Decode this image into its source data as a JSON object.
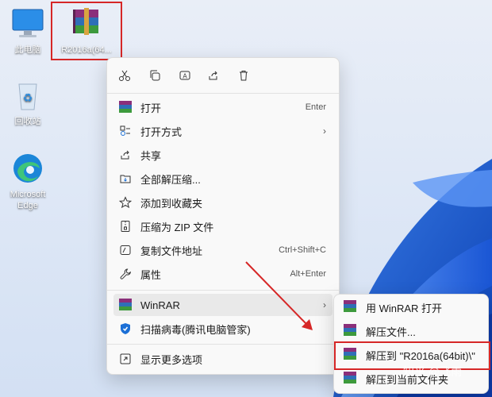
{
  "desktop": {
    "icons": [
      {
        "label": "此电脑",
        "icon": "computer-icon"
      },
      {
        "label": "R2016a(64...",
        "icon": "winrar-archive-icon"
      },
      {
        "label": "回收站",
        "icon": "recycle-bin-icon"
      },
      {
        "label": "Microsoft Edge",
        "icon": "edge-icon"
      }
    ]
  },
  "context_menu": {
    "toolbar": [
      "cut-icon",
      "copy-icon",
      "rename-icon",
      "share-icon",
      "delete-icon"
    ],
    "items": [
      {
        "label": "打开",
        "shortcut": "Enter",
        "icon": "winrar-icon"
      },
      {
        "label": "打开方式",
        "submenu": "›",
        "icon": "open-with-icon"
      },
      {
        "label": "共享",
        "icon": "share-icon"
      },
      {
        "label": "全部解压缩...",
        "icon": "extract-all-icon"
      },
      {
        "label": "添加到收藏夹",
        "icon": "star-icon"
      },
      {
        "label": "压缩为 ZIP 文件",
        "icon": "zip-icon"
      },
      {
        "label": "复制文件地址",
        "shortcut": "Ctrl+Shift+C",
        "icon": "copy-path-icon"
      },
      {
        "label": "属性",
        "shortcut": "Alt+Enter",
        "icon": "wrench-icon"
      },
      {
        "label": "WinRAR",
        "submenu": "›",
        "icon": "winrar-icon"
      },
      {
        "label": "扫描病毒(腾讯电脑管家)",
        "icon": "shield-icon"
      },
      {
        "label": "显示更多选项",
        "icon": "more-options-icon"
      }
    ]
  },
  "winrar_submenu": {
    "items": [
      {
        "label": "用 WinRAR 打开"
      },
      {
        "label": "解压文件..."
      },
      {
        "label": "解压到 \"R2016a(64bit)\\\""
      },
      {
        "label": "解压到当前文件夹"
      }
    ]
  },
  "watermark": "知乎 @飞雨",
  "colors": {
    "highlight_box": "#d62727",
    "arrow": "#d62727"
  }
}
